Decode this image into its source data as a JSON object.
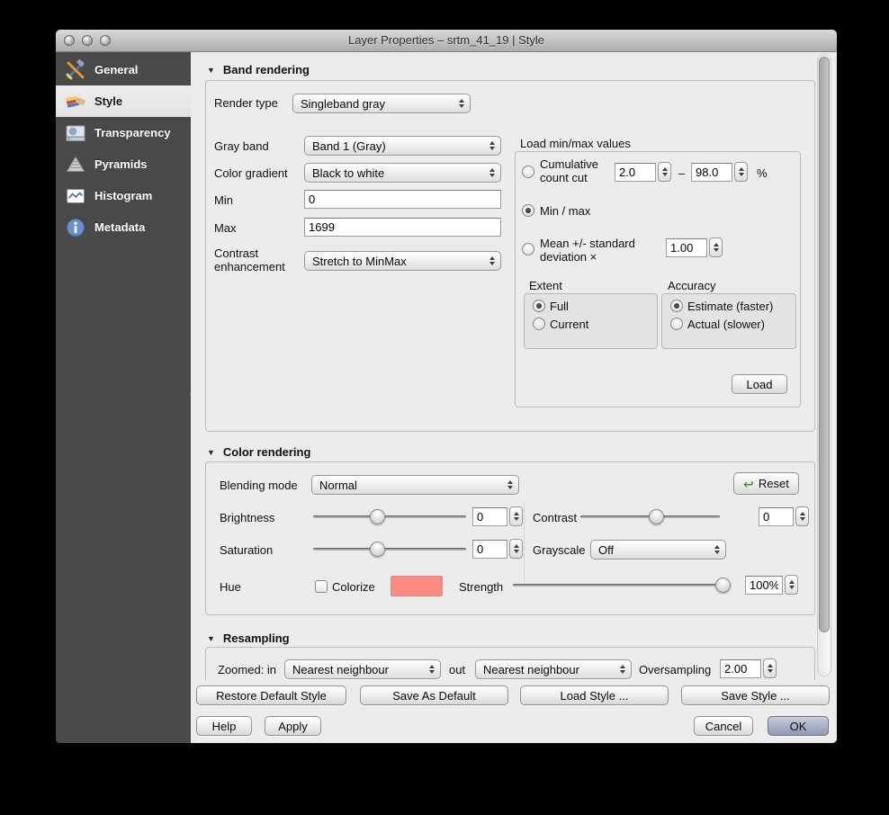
{
  "window": {
    "title": "Layer Properties – srtm_41_19 | Style"
  },
  "sidebar": {
    "items": [
      {
        "label": "General",
        "icon": "tools-icon",
        "selected": false
      },
      {
        "label": "Style",
        "icon": "paintbrush-icon",
        "selected": true
      },
      {
        "label": "Transparency",
        "icon": "transparency-icon",
        "selected": false
      },
      {
        "label": "Pyramids",
        "icon": "pyramids-icon",
        "selected": false
      },
      {
        "label": "Histogram",
        "icon": "histogram-icon",
        "selected": false
      },
      {
        "label": "Metadata",
        "icon": "info-icon",
        "selected": false
      }
    ]
  },
  "band_rendering": {
    "section_title": "Band rendering",
    "collapse_icon": "▼",
    "render_type_label": "Render type",
    "render_type_value": "Singleband gray",
    "gray_band_label": "Gray band",
    "gray_band_value": "Band 1 (Gray)",
    "color_gradient_label": "Color gradient",
    "color_gradient_value": "Black to white",
    "min_label": "Min",
    "min_value": "0",
    "max_label": "Max",
    "max_value": "1699",
    "contrast_enhancement_label": "Contrast enhancement",
    "contrast_enhancement_value": "Stretch to MinMax",
    "load_minmax": {
      "title": "Load min/max values",
      "cumulative_label": "Cumulative count cut",
      "cumulative_min": "2.0",
      "dash": "–",
      "cumulative_max": "98.0",
      "percent": "%",
      "minmax_label": "Min / max",
      "mean_label": "Mean +/- standard deviation ×",
      "stddev_value": "1.00",
      "selected_method": "Min / max",
      "extent": {
        "title": "Extent",
        "options": [
          "Full",
          "Current"
        ],
        "selected": "Full"
      },
      "accuracy": {
        "title": "Accuracy",
        "options": [
          "Estimate (faster)",
          "Actual (slower)"
        ],
        "selected": "Estimate (faster)"
      },
      "load_button": "Load"
    }
  },
  "color_rendering": {
    "section_title": "Color rendering",
    "collapse_icon": "▼",
    "blending_mode_label": "Blending mode",
    "blending_mode_value": "Normal",
    "reset_button": "Reset",
    "reset_icon": "↩",
    "brightness_label": "Brightness",
    "brightness_value": "0",
    "contrast_label": "Contrast",
    "contrast_value": "0",
    "saturation_label": "Saturation",
    "saturation_value": "0",
    "grayscale_label": "Grayscale",
    "grayscale_value": "Off",
    "hue_label": "Hue",
    "colorize_label": "Colorize",
    "colorize_checked": false,
    "colorize_color": "#fb8a80",
    "strength_label": "Strength",
    "strength_value": "100%"
  },
  "resampling": {
    "section_title": "Resampling",
    "collapse_icon": "▼",
    "zoomed_label": "Zoomed: in",
    "zoomed_in_value": "Nearest neighbour",
    "out_label": "out",
    "out_value": "Nearest neighbour",
    "oversampling_label": "Oversampling",
    "oversampling_value": "2.00"
  },
  "footer": {
    "restore_default_style": "Restore Default Style",
    "save_as_default": "Save As Default",
    "load_style": "Load Style ...",
    "save_style": "Save Style ...",
    "help": "Help",
    "apply": "Apply",
    "cancel": "Cancel",
    "ok": "OK"
  },
  "colors": {
    "sidebar_bg": "#494949",
    "content_bg": "#ececec",
    "default_button": "#a8b1c6",
    "reset_icon_green": "#3f9c35"
  }
}
